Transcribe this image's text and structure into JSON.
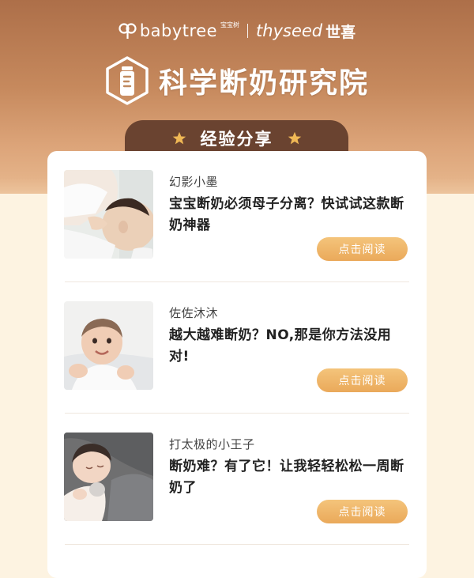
{
  "brand": {
    "babytree_name": "babytree",
    "babytree_cn": "宝宝树",
    "thyseed_name": "thyseed",
    "thyseed_cn": "世喜"
  },
  "header": {
    "title": "科学断奶研究院"
  },
  "section": {
    "title": "经验分享"
  },
  "articles": [
    {
      "author": "幻影小墨",
      "headline": "宝宝断奶必须母子分离？快试试这款断奶神器",
      "button_label": "点击阅读"
    },
    {
      "author": "佐佐沐沐",
      "headline": "越大越难断奶？NO,那是你方法没用对!",
      "button_label": "点击阅读"
    },
    {
      "author": "打太极的小王子",
      "headline": "断奶难？有了它！让我轻轻松松一周断奶了",
      "button_label": "点击阅读"
    }
  ],
  "colors": {
    "hero_top": "#ad6f49",
    "hero_bottom": "#e8b98f",
    "tab_bg": "#6a4330",
    "button": "#eaa95a",
    "page_bg": "#fdf3e1"
  }
}
